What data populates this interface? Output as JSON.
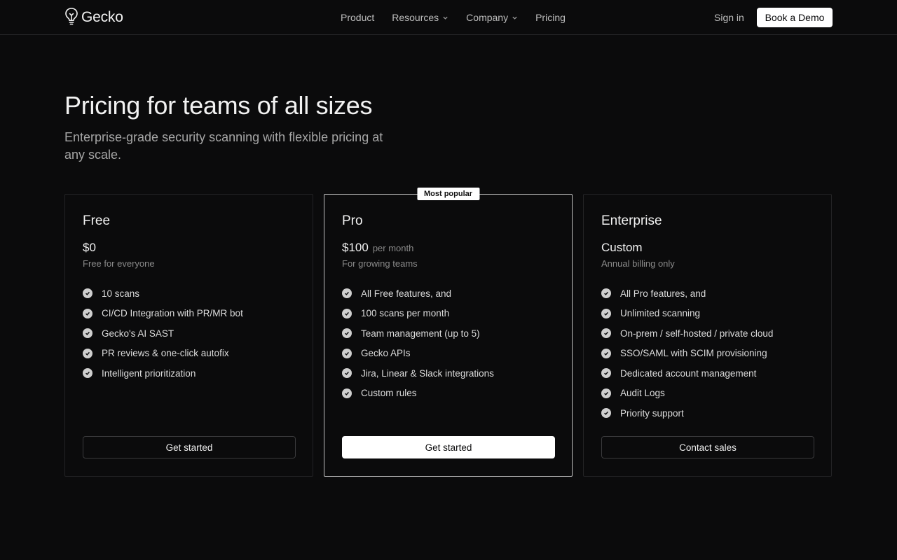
{
  "nav": {
    "brand": "Gecko",
    "links": [
      {
        "label": "Product",
        "dropdown": false
      },
      {
        "label": "Resources",
        "dropdown": true
      },
      {
        "label": "Company",
        "dropdown": true
      },
      {
        "label": "Pricing",
        "dropdown": false
      }
    ],
    "sign_in": "Sign in",
    "demo": "Book a Demo"
  },
  "hero": {
    "title": "Pricing for teams of all sizes",
    "subtitle": "Enterprise-grade security scanning with flexible pricing at any scale."
  },
  "plans": [
    {
      "name": "Free",
      "price": "$0",
      "price_unit": "",
      "description": "Free for everyone",
      "badge": "",
      "features": [
        "10 scans",
        "CI/CD Integration with PR/MR bot",
        "Gecko's AI SAST",
        "PR reviews & one-click autofix",
        "Intelligent prioritization"
      ],
      "cta": "Get started"
    },
    {
      "name": "Pro",
      "price": "$100",
      "price_unit": "per month",
      "description": "For growing teams",
      "badge": "Most popular",
      "features": [
        "All Free features, and",
        "100 scans per month",
        "Team management (up to 5)",
        "Gecko APIs",
        "Jira, Linear & Slack integrations",
        "Custom rules"
      ],
      "cta": "Get started"
    },
    {
      "name": "Enterprise",
      "price": "Custom",
      "price_unit": "",
      "description": "Annual billing only",
      "badge": "",
      "features": [
        "All Pro features, and",
        "Unlimited scanning",
        "On-prem / self-hosted / private cloud",
        "SSO/SAML with SCIM provisioning",
        "Dedicated account management",
        "Audit Logs",
        "Priority support"
      ],
      "cta": "Contact sales"
    }
  ],
  "colors": {
    "background": "#0b0b0c",
    "accent": "#ffffff",
    "muted": "#8a8a8a"
  },
  "icons": {
    "logo": "lightbulb-icon",
    "dropdown": "chevron-down-icon",
    "feature": "check-circle-icon"
  }
}
